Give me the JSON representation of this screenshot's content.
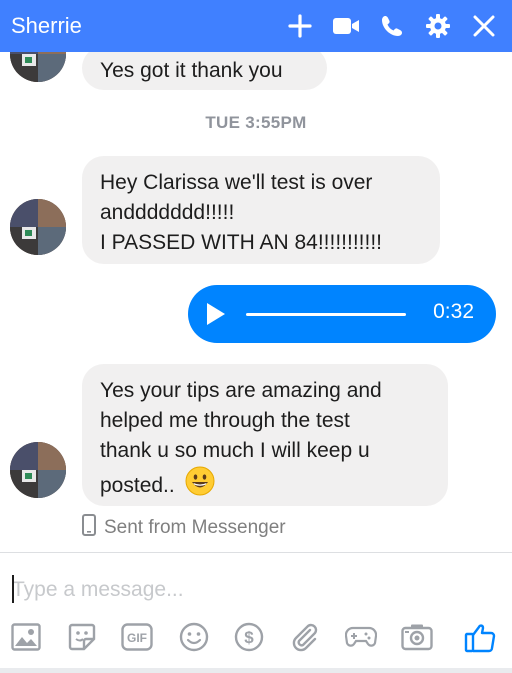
{
  "header": {
    "title": "Sherrie",
    "icons": [
      "plus-icon",
      "video-camera-icon",
      "phone-icon",
      "gear-icon",
      "close-icon"
    ],
    "color": "#4080ff"
  },
  "messages": {
    "first": "Yes got it thank you",
    "timestamp": "TUE 3:55PM",
    "second_lines": [
      "Hey Clarissa we'll test is over",
      "anddddddd!!!!!",
      "I PASSED WITH AN 84!!!!!!!!!!!"
    ],
    "audio_duration": "0:32",
    "third_lines": [
      "Yes your tips are amazing and",
      "helped me through the test",
      "thank u so much I will keep u",
      "posted.."
    ],
    "sent_from": "Sent from Messenger"
  },
  "composer": {
    "placeholder": "Type a message...",
    "toolbar_icons": [
      "image-icon",
      "sticker-icon",
      "gif-icon",
      "emoji-icon",
      "payment-icon",
      "attachment-icon",
      "game-icon",
      "camera-icon",
      "like-icon"
    ]
  },
  "colors": {
    "accent": "#0084ff",
    "bubble": "#f1f0f0",
    "like": "#0084ff"
  }
}
